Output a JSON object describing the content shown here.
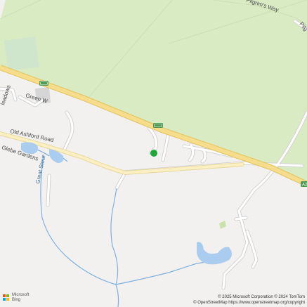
{
  "labels": {
    "old_ashford_road": "Old Ashford Road",
    "great_stour": "Great Stour",
    "glebe_gardens": "Glebe Gardens",
    "pilgrims_way_1": "Pilgrim's Way",
    "pilgrims_way_2": "Pilg",
    "green_way": "Green W",
    "meadows": "leadows",
    "road_edge": "A2"
  },
  "colors": {
    "background": "#f2f1ef",
    "woodland": "#d9ebc3",
    "park": "#cfe6cc",
    "major_road": "#f6dd8b",
    "major_road_casing": "#e3c25c",
    "minor_road": "#ffffff",
    "minor_road_casing": "#cfcfcf",
    "water": "#a9ccef",
    "water_stroke": "#7fb0e0",
    "road_shield": "#4f9a55",
    "location_pin": "#22a83a"
  },
  "branding": {
    "line1": "Microsoft",
    "line2": "Bing",
    "logo_icon": "microsoft-logo-icon"
  },
  "attribution": {
    "line1": "© 2025 Microsoft Corporation © 2024 TomTom",
    "line2": "© OpenStreetMap https://www.openstreetmap.org/copyright"
  }
}
